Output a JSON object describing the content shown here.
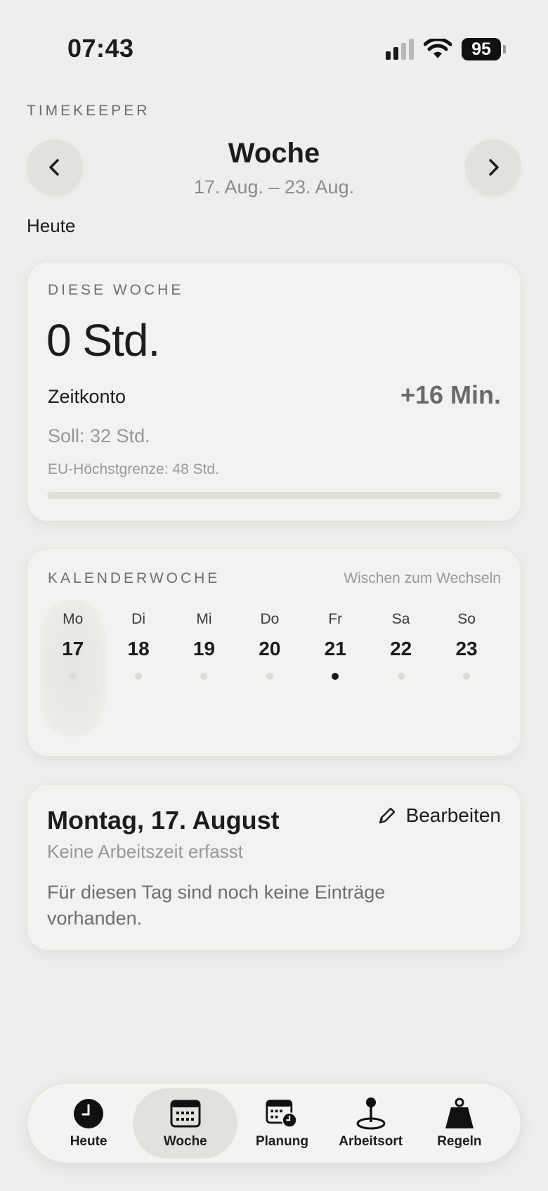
{
  "status_bar": {
    "time": "07:43",
    "battery": "95",
    "signal_icon": "cellular-signal-icon",
    "wifi_icon": "wifi-icon"
  },
  "header": {
    "app_label": "TIMEKEEPER",
    "title": "Woche",
    "date_range": "17. Aug. – 23. Aug.",
    "today_link": "Heute",
    "prev_icon": "chevron-left-icon",
    "next_icon": "chevron-right-icon"
  },
  "week_summary": {
    "eyebrow": "DIESE WOCHE",
    "hours": "0 Std.",
    "account_label": "Zeitkonto",
    "account_value": "+16 Min.",
    "target": "Soll: 32 Std.",
    "eu_limit": "EU-Höchstgrenze: 48 Std.",
    "progress_fraction": 0
  },
  "calendar_week": {
    "eyebrow": "KALENDERWOCHE",
    "swipe_hint": "Wischen zum Wechseln",
    "days": [
      {
        "name": "Mo",
        "num": "17",
        "selected": true,
        "has_entry": false
      },
      {
        "name": "Di",
        "num": "18",
        "selected": false,
        "has_entry": false
      },
      {
        "name": "Mi",
        "num": "19",
        "selected": false,
        "has_entry": false
      },
      {
        "name": "Do",
        "num": "20",
        "selected": false,
        "has_entry": false
      },
      {
        "name": "Fr",
        "num": "21",
        "selected": false,
        "has_entry": true
      },
      {
        "name": "Sa",
        "num": "22",
        "selected": false,
        "has_entry": false
      },
      {
        "name": "So",
        "num": "23",
        "selected": false,
        "has_entry": false
      }
    ]
  },
  "day_detail": {
    "title": "Montag, 17. August",
    "edit_label": "Bearbeiten",
    "edit_icon": "pencil-icon",
    "subtitle": "Keine Arbeitszeit erfasst",
    "message": "Für diesen Tag sind noch keine Einträge vorhanden."
  },
  "tabbar": {
    "tabs": [
      {
        "label": "Heute",
        "icon": "clock-icon",
        "active": false
      },
      {
        "label": "Woche",
        "icon": "calendar-icon",
        "active": true
      },
      {
        "label": "Planung",
        "icon": "calendar-clock-icon",
        "active": false
      },
      {
        "label": "Arbeitsort",
        "icon": "location-pin-icon",
        "active": false
      },
      {
        "label": "Regeln",
        "icon": "weight-icon",
        "active": false
      }
    ]
  }
}
